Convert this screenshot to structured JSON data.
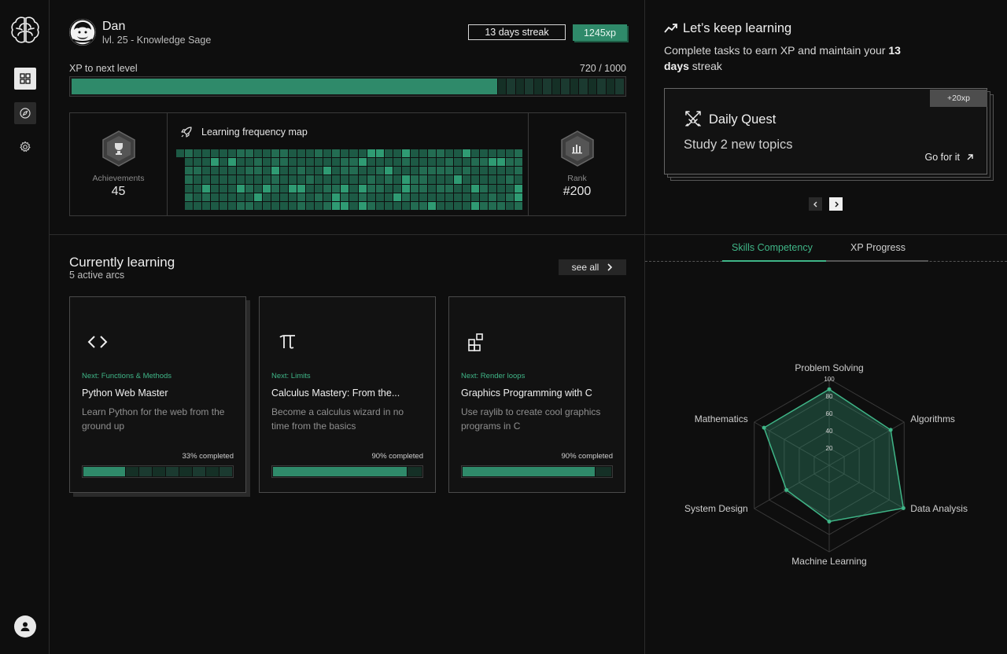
{
  "user": {
    "name": "Dan",
    "level": "lvl. 25 - Knowledge Sage",
    "streak": "13 days streak",
    "xp": "1245xp",
    "xp_label": "XP to next level",
    "xp_progress": "720 / 1000",
    "xp_fraction": 0.77
  },
  "stats": {
    "achievements_label": "Achievements",
    "achievements_value": "45",
    "rank_label": "Rank",
    "rank_value": "#200",
    "heatmap_title": "Learning frequency map"
  },
  "learning": {
    "title": "Currently learning",
    "subtitle": "5 active arcs",
    "see_all": "see all",
    "courses": [
      {
        "next": "Next: Functions & Methods",
        "name": "Python Web Master",
        "desc": "Learn Python for the web from the ground up",
        "pct_label": "33% completed",
        "pct": 0.28,
        "icon": "code-icon"
      },
      {
        "next": "Next: Limits",
        "name": "Calculus Mastery: From the...",
        "desc": "Become a calculus wizard in no time from the basics",
        "pct_label": "90% completed",
        "pct": 0.9,
        "icon": "pi-icon"
      },
      {
        "next": "Next: Render loops",
        "name": "Graphics Programming with C",
        "desc": "Use raylib to create cool graphics programs in C",
        "pct_label": "90% completed",
        "pct": 0.89,
        "icon": "blocks-icon"
      }
    ]
  },
  "keep_learning": {
    "title": "Let’s keep learning",
    "sub_prefix": "Complete tasks to earn XP and maintain your ",
    "sub_bold": "13 days",
    "sub_suffix": " streak"
  },
  "quest": {
    "xp": "+20xp",
    "title": "Daily Quest",
    "task": "Study 2 new topics",
    "go": "Go for it"
  },
  "tabs": [
    "Skills Competency",
    "XP Progress"
  ],
  "chart_data": {
    "type": "radar",
    "axes": [
      "Problem Solving",
      "Algorithms",
      "Data Analysis",
      "Machine Learning",
      "System Design",
      "Mathematics"
    ],
    "values": [
      88,
      82,
      99,
      65,
      57,
      87
    ],
    "ticks": [
      "20",
      "40",
      "60",
      "80",
      "100"
    ],
    "range": [
      0,
      100
    ]
  },
  "colors": {
    "accent": "#3fb587",
    "fill": "#2f8a6a"
  }
}
